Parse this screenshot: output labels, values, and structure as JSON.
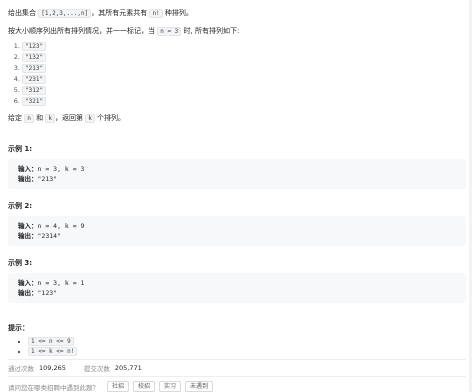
{
  "intro": {
    "p1_a": "给出集合",
    "p1_set": "[1,2,3,...,n]",
    "p1_b": "，其所有元素共有",
    "p1_nfact": "n!",
    "p1_c": "种排列。",
    "p2_a": "按大小顺序列出所有排列情况，并一一标记，当",
    "p2_code": "n = 3",
    "p2_b": "时, 所有排列如下:"
  },
  "permutations": [
    "\"123\"",
    "\"132\"",
    "\"213\"",
    "\"231\"",
    "\"312\"",
    "\"321\""
  ],
  "task": {
    "a": "给定",
    "n": "n",
    "and": "和",
    "k": "k",
    "b": "，返回第",
    "k2": "k",
    "c": "个排列。"
  },
  "examples": [
    {
      "title": "示例 1:",
      "input_label": "输入：",
      "input": "n = 3, k = 3",
      "output_label": "输出：",
      "output": "\"213\""
    },
    {
      "title": "示例 2:",
      "input_label": "输入：",
      "input": "n = 4, k = 9",
      "output_label": "输出：",
      "output": "\"2314\""
    },
    {
      "title": "示例 3:",
      "input_label": "输入：",
      "input": "n = 3, k = 1",
      "output_label": "输出：",
      "output": "\"123\""
    }
  ],
  "hints": {
    "title": "提示：",
    "items": [
      "1 <= n <= 9",
      "1 <= k <= n!"
    ]
  },
  "stats": {
    "pass_label": "通过次数",
    "pass_value": "109,265",
    "submit_label": "提交次数",
    "submit_value": "205,771"
  },
  "interview": {
    "question": "请问您在哪类招聘中遇到此题？",
    "tags": [
      "社招",
      "校招",
      "实习",
      "未遇到"
    ]
  }
}
